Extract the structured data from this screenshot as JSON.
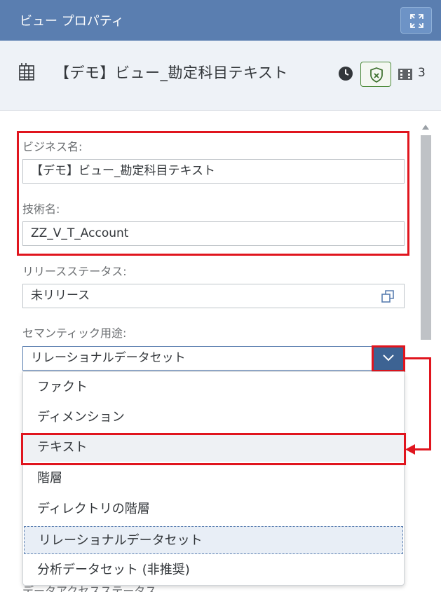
{
  "titlebar": {
    "title": "ビュー プロパティ",
    "expand_icon": "expand-icon"
  },
  "header": {
    "icon": "table-grid-icon",
    "title": "【デモ】ビュー_勘定科目テキスト",
    "clock_icon": "clock-icon",
    "shield_icon": "shield-check-icon",
    "film_icon": "film-icon",
    "count": "3"
  },
  "form": {
    "business_name": {
      "label": "ビジネス名:",
      "value": "【デモ】ビュー_勘定科目テキスト"
    },
    "technical_name": {
      "label": "技術名:",
      "value": "ZZ_V_T_Account"
    },
    "release_status": {
      "label": "リリースステータス:",
      "value": "未リリース",
      "icon": "copy-icon"
    },
    "semantic_usage": {
      "label": "セマンティック用途:",
      "value": "リレーショナルデータセット",
      "options": [
        "ファクト",
        "ディメンション",
        "テキスト",
        "階層",
        "ディレクトリの階層",
        "リレーショナルデータセット",
        "分析データセット (非推奨)"
      ]
    },
    "behind_label": "データアクセスステータス"
  },
  "colors": {
    "titlebar": "#5a7eb0",
    "highlight": "#e0151e",
    "dropdown_button": "#3d6393"
  }
}
